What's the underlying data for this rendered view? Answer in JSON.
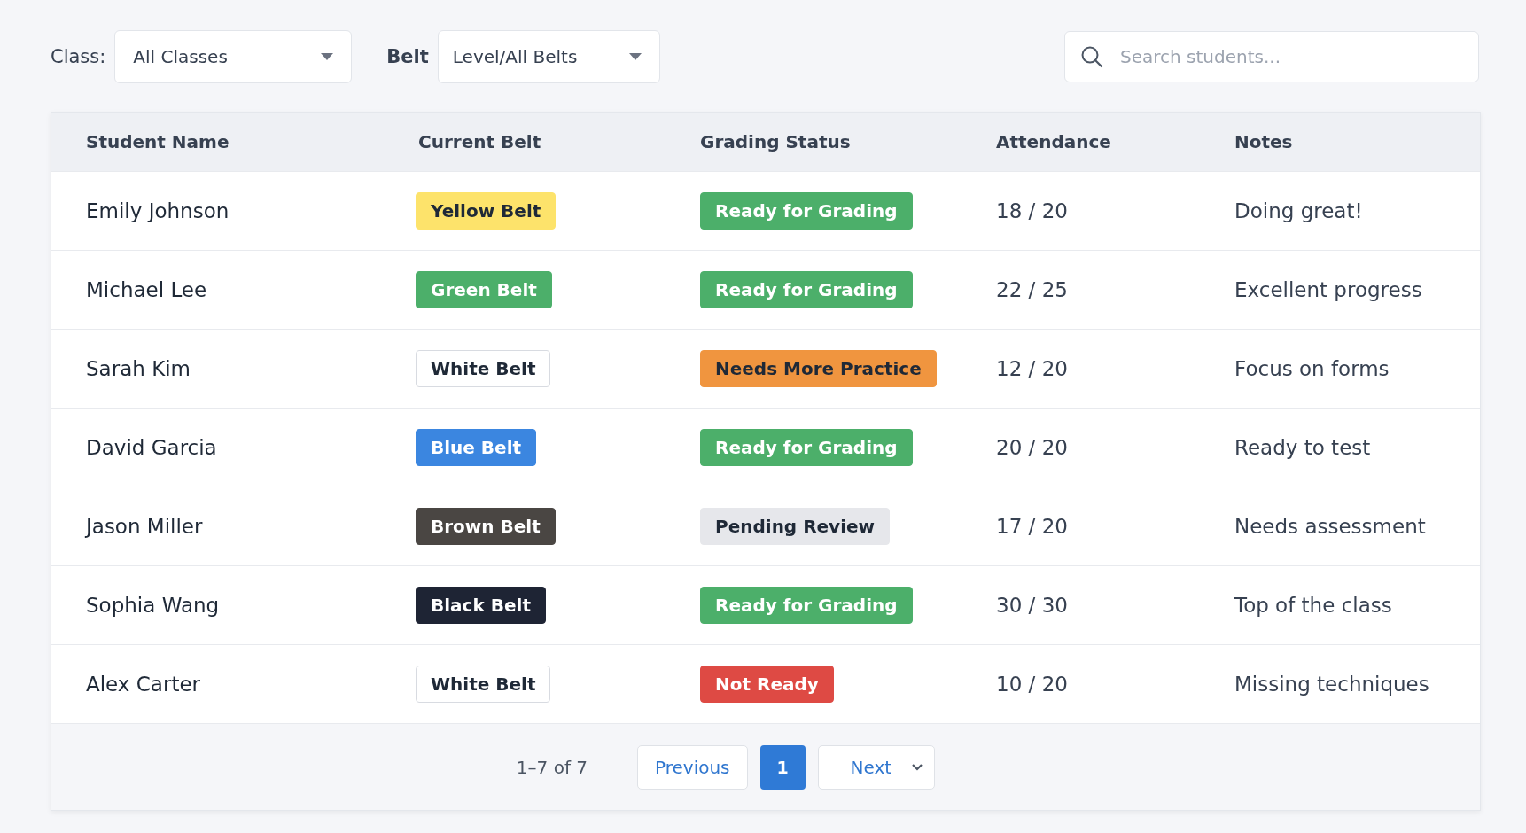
{
  "filters": {
    "class_label": "Class:",
    "class_value": "All Classes",
    "belt_label": "Belt",
    "belt_value": "Level/All Belts",
    "search": {
      "placeholder": "Search students..."
    }
  },
  "table": {
    "columns": [
      "Student Name",
      "Current Belt",
      "Grading Status",
      "Attendance",
      "Notes"
    ],
    "rows": [
      {
        "name": "Emily Johnson",
        "belt": {
          "label": "Yellow Belt",
          "color": "#fde36b"
        },
        "status": {
          "label": "Ready for Grading",
          "color": "#4caf6a"
        },
        "attendance": "18 / 20",
        "notes": "Doing great!"
      },
      {
        "name": "Michael Lee",
        "belt": {
          "label": "Green Belt",
          "color": "#4caf6a"
        },
        "status": {
          "label": "Ready for Grading",
          "color": "#4caf6a"
        },
        "attendance": "22 / 25",
        "notes": "Excellent progress"
      },
      {
        "name": "Sarah Kim",
        "belt": {
          "label": "White Belt",
          "color": "#ffffff"
        },
        "status": {
          "label": "Needs More Practice",
          "color": "#f0953f"
        },
        "attendance": "12 / 20",
        "notes": "Focus on forms"
      },
      {
        "name": "David Garcia",
        "belt": {
          "label": "Blue Belt",
          "color": "#3b86e0"
        },
        "status": {
          "label": "Ready for Grading",
          "color": "#4caf6a"
        },
        "attendance": "20 / 20",
        "notes": "Ready to test"
      },
      {
        "name": "Jason Miller",
        "belt": {
          "label": "Brown Belt",
          "color": "#4a4643"
        },
        "status": {
          "label": "Pending Review",
          "color": "#e6e7eb"
        },
        "attendance": "17 / 20",
        "notes": "Needs assessment"
      },
      {
        "name": "Sophia Wang",
        "belt": {
          "label": "Black Belt",
          "color": "#1e2434"
        },
        "status": {
          "label": "Ready for Grading",
          "color": "#4caf6a"
        },
        "attendance": "30 / 30",
        "notes": "Top of the class"
      },
      {
        "name": "Alex Carter",
        "belt": {
          "label": "White Belt",
          "color": "#ffffff"
        },
        "status": {
          "label": "Not Ready",
          "color": "#de4a44"
        },
        "attendance": "10 / 20",
        "notes": "Missing techniques"
      }
    ]
  },
  "pagination": {
    "range": "1–7 of 7",
    "previous": "Previous",
    "pages": [
      {
        "label": "1",
        "selected": true
      }
    ],
    "next": "Next"
  }
}
